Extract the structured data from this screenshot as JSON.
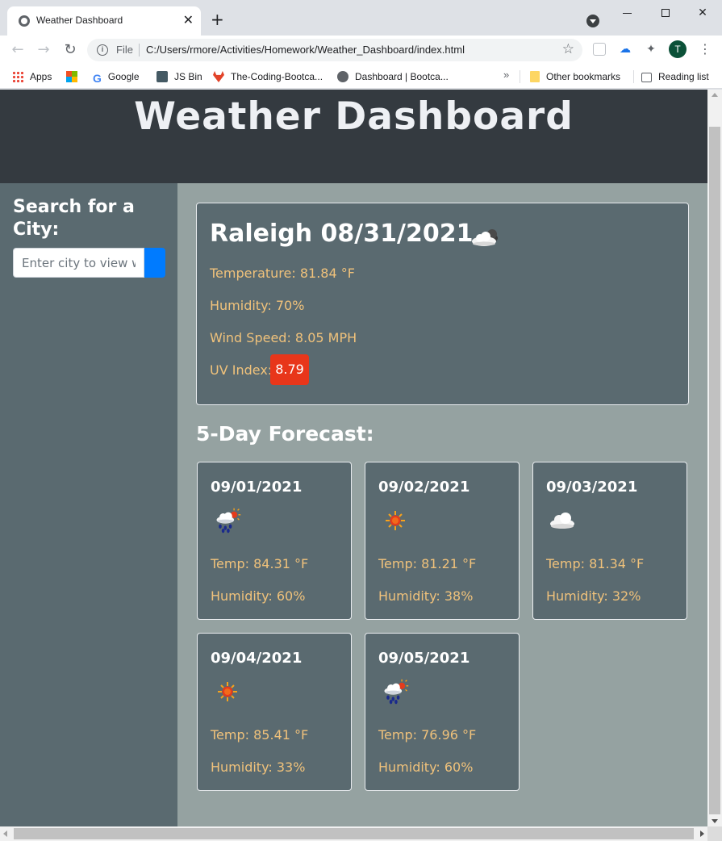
{
  "browser": {
    "tab_title": "Weather Dashboard",
    "new_tab": "+",
    "url_scheme": "File",
    "url": "C:/Users/rmore/Activities/Homework/Weather_Dashboard/index.html",
    "avatar_letter": "T",
    "bookmarks": [
      {
        "label": "Apps",
        "icon": "apps-grid-icon"
      },
      {
        "label": "",
        "icon": "microsoft-icon"
      },
      {
        "label": "Google",
        "icon": "google-icon"
      },
      {
        "label": "JS Bin",
        "icon": "jsbin-icon"
      },
      {
        "label": "The-Coding-Bootca...",
        "icon": "gitlab-icon"
      },
      {
        "label": "Dashboard | Bootca...",
        "icon": "globe-icon"
      }
    ],
    "other_bookmarks": "Other bookmarks",
    "reading_list": "Reading list"
  },
  "page": {
    "title": "Weather Dashboard",
    "search": {
      "heading": "Search for a City:",
      "placeholder": "Enter city to view weather"
    },
    "current": {
      "heading": "Raleigh 08/31/2021",
      "icon": "partly-cloudy-icon",
      "temperature": "Temperature: 81.84 °F",
      "humidity": "Humidity: 70%",
      "wind": "Wind Speed: 8.05 MPH",
      "uv_label": "UV Index:",
      "uv_value": "8.79",
      "uv_color": "#e8361a"
    },
    "forecast_title": "5-Day Forecast:",
    "forecast": [
      {
        "date": "09/01/2021",
        "icon": "rain-sun-icon",
        "temp": "Temp: 84.31 °F",
        "humidity": "Humidity: 60%"
      },
      {
        "date": "09/02/2021",
        "icon": "sun-icon",
        "temp": "Temp: 81.21 °F",
        "humidity": "Humidity: 38%"
      },
      {
        "date": "09/03/2021",
        "icon": "cloud-icon",
        "temp": "Temp: 81.34 °F",
        "humidity": "Humidity: 32%"
      },
      {
        "date": "09/04/2021",
        "icon": "sun-icon",
        "temp": "Temp: 85.41 °F",
        "humidity": "Humidity: 33%"
      },
      {
        "date": "09/05/2021",
        "icon": "rain-sun-icon",
        "temp": "Temp: 76.96 °F",
        "humidity": "Humidity: 60%"
      }
    ]
  },
  "colors": {
    "header_bg": "#343a40",
    "sidebar_bg": "#5a6a70",
    "main_bg": "#95a2a1",
    "detail_text": "#f0c27b",
    "search_button": "#007bff"
  }
}
